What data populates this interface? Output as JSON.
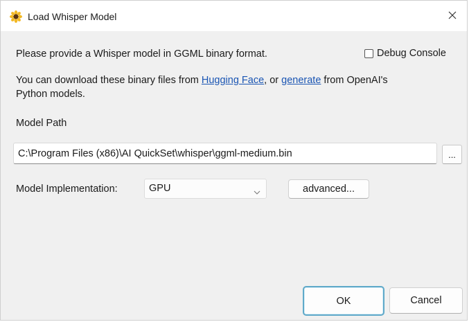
{
  "window": {
    "title": "Load Whisper Model",
    "icon": "sunflower-icon",
    "close_icon": "close-icon"
  },
  "intro": {
    "text": "Please provide a Whisper model in GGML binary format."
  },
  "debug_console": {
    "label": "Debug Console",
    "checked": false
  },
  "download_note": {
    "prefix": "You can download these binary files from ",
    "link1": "Hugging Face",
    "middle": ", or ",
    "link2": "generate",
    "suffix_line1": " from OpenAI's",
    "line2": "Python models."
  },
  "model_path": {
    "label": "Model Path",
    "value": "C:\\Program Files (x86)\\AI QuickSet\\whisper\\ggml-medium.bin",
    "browse_label": "..."
  },
  "implementation": {
    "label": "Model Implementation:",
    "selected": "GPU",
    "advanced_label": "advanced..."
  },
  "footer": {
    "ok_label": "OK",
    "cancel_label": "Cancel"
  },
  "colors": {
    "link": "#1a55b3",
    "ok_focus_border": "#5fa9c9",
    "dialog_bg": "#f0f0f0"
  }
}
